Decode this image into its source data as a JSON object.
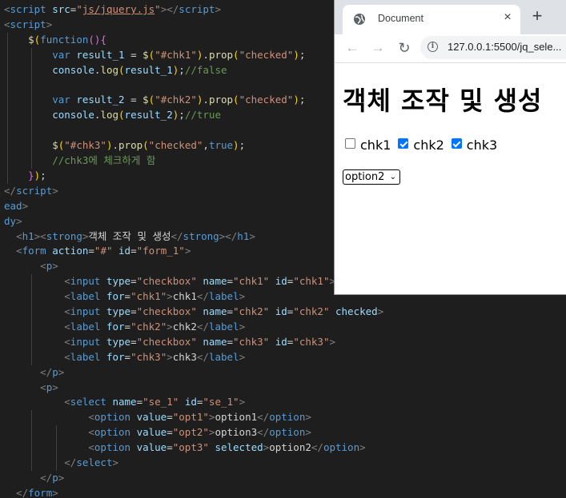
{
  "code_lines": [
    [
      [
        "t-br",
        "<"
      ],
      [
        "t-tag",
        "script "
      ],
      [
        "t-attr",
        "src"
      ],
      [
        "t-punc",
        "="
      ],
      [
        "t-str",
        "\""
      ],
      [
        "t-link",
        "js/jquery.js"
      ],
      [
        "t-str",
        "\""
      ],
      [
        "t-br",
        ">"
      ],
      [
        "t-br",
        "</"
      ],
      [
        "t-tag",
        "script"
      ],
      [
        "t-br",
        ">"
      ]
    ],
    [
      [
        "t-br",
        "<"
      ],
      [
        "t-tag",
        "script"
      ],
      [
        "t-br",
        ">"
      ]
    ],
    [
      [
        "t-txt",
        "    "
      ],
      [
        "t-fn",
        "$"
      ],
      [
        "t-paren1",
        "("
      ],
      [
        "t-kw",
        "function"
      ],
      [
        "t-paren2",
        "()"
      ],
      [
        "t-paren2",
        "{"
      ]
    ],
    [
      [
        "t-txt",
        "        "
      ],
      [
        "t-kw",
        "var "
      ],
      [
        "t-var",
        "result_1"
      ],
      [
        "t-punc",
        " = "
      ],
      [
        "t-fn",
        "$"
      ],
      [
        "t-paren1",
        "("
      ],
      [
        "t-str",
        "\"#chk1\""
      ],
      [
        "t-paren1",
        ")"
      ],
      [
        "t-punc",
        "."
      ],
      [
        "t-fn",
        "prop"
      ],
      [
        "t-paren1",
        "("
      ],
      [
        "t-str",
        "\"checked\""
      ],
      [
        "t-paren1",
        ")"
      ],
      [
        "t-punc",
        ";"
      ]
    ],
    [
      [
        "t-txt",
        "        "
      ],
      [
        "t-var",
        "console"
      ],
      [
        "t-punc",
        "."
      ],
      [
        "t-fn",
        "log"
      ],
      [
        "t-paren1",
        "("
      ],
      [
        "t-var",
        "result_1"
      ],
      [
        "t-paren1",
        ")"
      ],
      [
        "t-punc",
        ";"
      ],
      [
        "t-cmt",
        "//false"
      ]
    ],
    [
      [
        "t-txt",
        ""
      ]
    ],
    [
      [
        "t-txt",
        "        "
      ],
      [
        "t-kw",
        "var "
      ],
      [
        "t-var",
        "result_2"
      ],
      [
        "t-punc",
        " = "
      ],
      [
        "t-fn",
        "$"
      ],
      [
        "t-paren1",
        "("
      ],
      [
        "t-str",
        "\"#chk2\""
      ],
      [
        "t-paren1",
        ")"
      ],
      [
        "t-punc",
        "."
      ],
      [
        "t-fn",
        "prop"
      ],
      [
        "t-paren1",
        "("
      ],
      [
        "t-str",
        "\"checked\""
      ],
      [
        "t-paren1",
        ")"
      ],
      [
        "t-punc",
        ";"
      ]
    ],
    [
      [
        "t-txt",
        "        "
      ],
      [
        "t-var",
        "console"
      ],
      [
        "t-punc",
        "."
      ],
      [
        "t-fn",
        "log"
      ],
      [
        "t-paren1",
        "("
      ],
      [
        "t-var",
        "result_2"
      ],
      [
        "t-paren1",
        ")"
      ],
      [
        "t-punc",
        ";"
      ],
      [
        "t-cmt",
        "//true"
      ]
    ],
    [
      [
        "t-txt",
        ""
      ]
    ],
    [
      [
        "t-txt",
        "        "
      ],
      [
        "t-fn",
        "$"
      ],
      [
        "t-paren1",
        "("
      ],
      [
        "t-str",
        "\"#chk3\""
      ],
      [
        "t-paren1",
        ")"
      ],
      [
        "t-punc",
        "."
      ],
      [
        "t-fn",
        "prop"
      ],
      [
        "t-paren1",
        "("
      ],
      [
        "t-str",
        "\"checked\""
      ],
      [
        "t-punc",
        ","
      ],
      [
        "t-bool",
        "true"
      ],
      [
        "t-paren1",
        ")"
      ],
      [
        "t-punc",
        ";"
      ]
    ],
    [
      [
        "t-txt",
        "        "
      ],
      [
        "t-cmt",
        "//chk3에 체크하게 함"
      ]
    ],
    [
      [
        "t-txt",
        "    "
      ],
      [
        "t-paren2",
        "}"
      ],
      [
        "t-paren1",
        ")"
      ],
      [
        "t-punc",
        ";"
      ]
    ],
    [
      [
        "t-br",
        "</"
      ],
      [
        "t-tag",
        "script"
      ],
      [
        "t-br",
        ">"
      ]
    ],
    [
      [
        "t-tag",
        "ead"
      ],
      [
        "t-br",
        ">"
      ]
    ],
    [
      [
        "t-tag",
        "dy"
      ],
      [
        "t-br",
        ">"
      ]
    ],
    [
      [
        "t-txt",
        "  "
      ],
      [
        "t-br",
        "<"
      ],
      [
        "t-tag",
        "h1"
      ],
      [
        "t-br",
        "><"
      ],
      [
        "t-tag",
        "strong"
      ],
      [
        "t-br",
        ">"
      ],
      [
        "t-txt",
        "객체 조작 및 생성"
      ],
      [
        "t-br",
        "</"
      ],
      [
        "t-tag",
        "strong"
      ],
      [
        "t-br",
        "></"
      ],
      [
        "t-tag",
        "h1"
      ],
      [
        "t-br",
        ">"
      ]
    ],
    [
      [
        "t-txt",
        "  "
      ],
      [
        "t-br",
        "<"
      ],
      [
        "t-tag",
        "form "
      ],
      [
        "t-attr",
        "action"
      ],
      [
        "t-punc",
        "="
      ],
      [
        "t-str",
        "\"#\" "
      ],
      [
        "t-attr",
        "id"
      ],
      [
        "t-punc",
        "="
      ],
      [
        "t-str",
        "\"form_1\""
      ],
      [
        "t-br",
        ">"
      ]
    ],
    [
      [
        "t-txt",
        "      "
      ],
      [
        "t-br",
        "<"
      ],
      [
        "t-tag",
        "p"
      ],
      [
        "t-br",
        ">"
      ]
    ],
    [
      [
        "t-txt",
        "          "
      ],
      [
        "t-br",
        "<"
      ],
      [
        "t-tag",
        "input "
      ],
      [
        "t-attr",
        "type"
      ],
      [
        "t-punc",
        "="
      ],
      [
        "t-str",
        "\"checkbox\" "
      ],
      [
        "t-attr",
        "name"
      ],
      [
        "t-punc",
        "="
      ],
      [
        "t-str",
        "\"chk1\" "
      ],
      [
        "t-attr",
        "id"
      ],
      [
        "t-punc",
        "="
      ],
      [
        "t-str",
        "\"chk1\""
      ],
      [
        "t-br",
        ">"
      ]
    ],
    [
      [
        "t-txt",
        "          "
      ],
      [
        "t-br",
        "<"
      ],
      [
        "t-tag",
        "label "
      ],
      [
        "t-attr",
        "for"
      ],
      [
        "t-punc",
        "="
      ],
      [
        "t-str",
        "\"chk1\""
      ],
      [
        "t-br",
        ">"
      ],
      [
        "t-txt",
        "chk1"
      ],
      [
        "t-br",
        "</"
      ],
      [
        "t-tag",
        "label"
      ],
      [
        "t-br",
        ">"
      ]
    ],
    [
      [
        "t-txt",
        "          "
      ],
      [
        "t-br",
        "<"
      ],
      [
        "t-tag",
        "input "
      ],
      [
        "t-attr",
        "type"
      ],
      [
        "t-punc",
        "="
      ],
      [
        "t-str",
        "\"checkbox\" "
      ],
      [
        "t-attr",
        "name"
      ],
      [
        "t-punc",
        "="
      ],
      [
        "t-str",
        "\"chk2\" "
      ],
      [
        "t-attr",
        "id"
      ],
      [
        "t-punc",
        "="
      ],
      [
        "t-str",
        "\"chk2\" "
      ],
      [
        "t-attr",
        "checked"
      ],
      [
        "t-br",
        ">"
      ]
    ],
    [
      [
        "t-txt",
        "          "
      ],
      [
        "t-br",
        "<"
      ],
      [
        "t-tag",
        "label "
      ],
      [
        "t-attr",
        "for"
      ],
      [
        "t-punc",
        "="
      ],
      [
        "t-str",
        "\"chk2\""
      ],
      [
        "t-br",
        ">"
      ],
      [
        "t-txt",
        "chk2"
      ],
      [
        "t-br",
        "</"
      ],
      [
        "t-tag",
        "label"
      ],
      [
        "t-br",
        ">"
      ]
    ],
    [
      [
        "t-txt",
        "          "
      ],
      [
        "t-br",
        "<"
      ],
      [
        "t-tag",
        "input "
      ],
      [
        "t-attr",
        "type"
      ],
      [
        "t-punc",
        "="
      ],
      [
        "t-str",
        "\"checkbox\" "
      ],
      [
        "t-attr",
        "name"
      ],
      [
        "t-punc",
        "="
      ],
      [
        "t-str",
        "\"chk3\" "
      ],
      [
        "t-attr",
        "id"
      ],
      [
        "t-punc",
        "="
      ],
      [
        "t-str",
        "\"chk3\""
      ],
      [
        "t-br",
        ">"
      ]
    ],
    [
      [
        "t-txt",
        "          "
      ],
      [
        "t-br",
        "<"
      ],
      [
        "t-tag",
        "label "
      ],
      [
        "t-attr",
        "for"
      ],
      [
        "t-punc",
        "="
      ],
      [
        "t-str",
        "\"chk3\""
      ],
      [
        "t-br",
        ">"
      ],
      [
        "t-txt",
        "chk3"
      ],
      [
        "t-br",
        "</"
      ],
      [
        "t-tag",
        "label"
      ],
      [
        "t-br",
        ">"
      ]
    ],
    [
      [
        "t-txt",
        "      "
      ],
      [
        "t-br",
        "</"
      ],
      [
        "t-tag",
        "p"
      ],
      [
        "t-br",
        ">"
      ]
    ],
    [
      [
        "t-txt",
        "      "
      ],
      [
        "t-br",
        "<"
      ],
      [
        "t-tag",
        "p"
      ],
      [
        "t-br",
        ">"
      ]
    ],
    [
      [
        "t-txt",
        "          "
      ],
      [
        "t-br",
        "<"
      ],
      [
        "t-tag",
        "select "
      ],
      [
        "t-attr",
        "name"
      ],
      [
        "t-punc",
        "="
      ],
      [
        "t-str",
        "\"se_1\" "
      ],
      [
        "t-attr",
        "id"
      ],
      [
        "t-punc",
        "="
      ],
      [
        "t-str",
        "\"se_1\""
      ],
      [
        "t-br",
        ">"
      ]
    ],
    [
      [
        "t-txt",
        "              "
      ],
      [
        "t-br",
        "<"
      ],
      [
        "t-tag",
        "option "
      ],
      [
        "t-attr",
        "value"
      ],
      [
        "t-punc",
        "="
      ],
      [
        "t-str",
        "\"opt1\""
      ],
      [
        "t-br",
        ">"
      ],
      [
        "t-txt",
        "option1"
      ],
      [
        "t-br",
        "</"
      ],
      [
        "t-tag",
        "option"
      ],
      [
        "t-br",
        ">"
      ]
    ],
    [
      [
        "t-txt",
        "              "
      ],
      [
        "t-br",
        "<"
      ],
      [
        "t-tag",
        "option "
      ],
      [
        "t-attr",
        "value"
      ],
      [
        "t-punc",
        "="
      ],
      [
        "t-str",
        "\"opt2\""
      ],
      [
        "t-br",
        ">"
      ],
      [
        "t-txt",
        "option3"
      ],
      [
        "t-br",
        "</"
      ],
      [
        "t-tag",
        "option"
      ],
      [
        "t-br",
        ">"
      ]
    ],
    [
      [
        "t-txt",
        "              "
      ],
      [
        "t-br",
        "<"
      ],
      [
        "t-tag",
        "option "
      ],
      [
        "t-attr",
        "value"
      ],
      [
        "t-punc",
        "="
      ],
      [
        "t-str",
        "\"opt3\" "
      ],
      [
        "t-attr",
        "selected"
      ],
      [
        "t-br",
        ">"
      ],
      [
        "t-txt",
        "option2"
      ],
      [
        "t-br",
        "</"
      ],
      [
        "t-tag",
        "option"
      ],
      [
        "t-br",
        ">"
      ]
    ],
    [
      [
        "t-txt",
        "          "
      ],
      [
        "t-br",
        "</"
      ],
      [
        "t-tag",
        "select"
      ],
      [
        "t-br",
        ">"
      ]
    ],
    [
      [
        "t-txt",
        "      "
      ],
      [
        "t-br",
        "</"
      ],
      [
        "t-tag",
        "p"
      ],
      [
        "t-br",
        ">"
      ]
    ],
    [
      [
        "t-txt",
        "  "
      ],
      [
        "t-br",
        "</"
      ],
      [
        "t-tag",
        "form"
      ],
      [
        "t-br",
        ">"
      ]
    ]
  ],
  "browser": {
    "tab_title": "Document",
    "tab_close": "×",
    "new_tab": "+",
    "back": "←",
    "forward": "→",
    "reload": "↻",
    "info": "i",
    "url": "127.0.0.1:5500/jq_sele...",
    "page": {
      "heading": "객체 조작 및 생성",
      "checkboxes": [
        {
          "label": "chk1",
          "checked": false
        },
        {
          "label": "chk2",
          "checked": true
        },
        {
          "label": "chk3",
          "checked": true
        }
      ],
      "select_value": "option2",
      "select_arrow": "⌄"
    }
  },
  "colors": {
    "editor_bg": "#1e1e1e",
    "checkbox_accent": "#0075ff",
    "tab_strip": "#dee1e6"
  }
}
